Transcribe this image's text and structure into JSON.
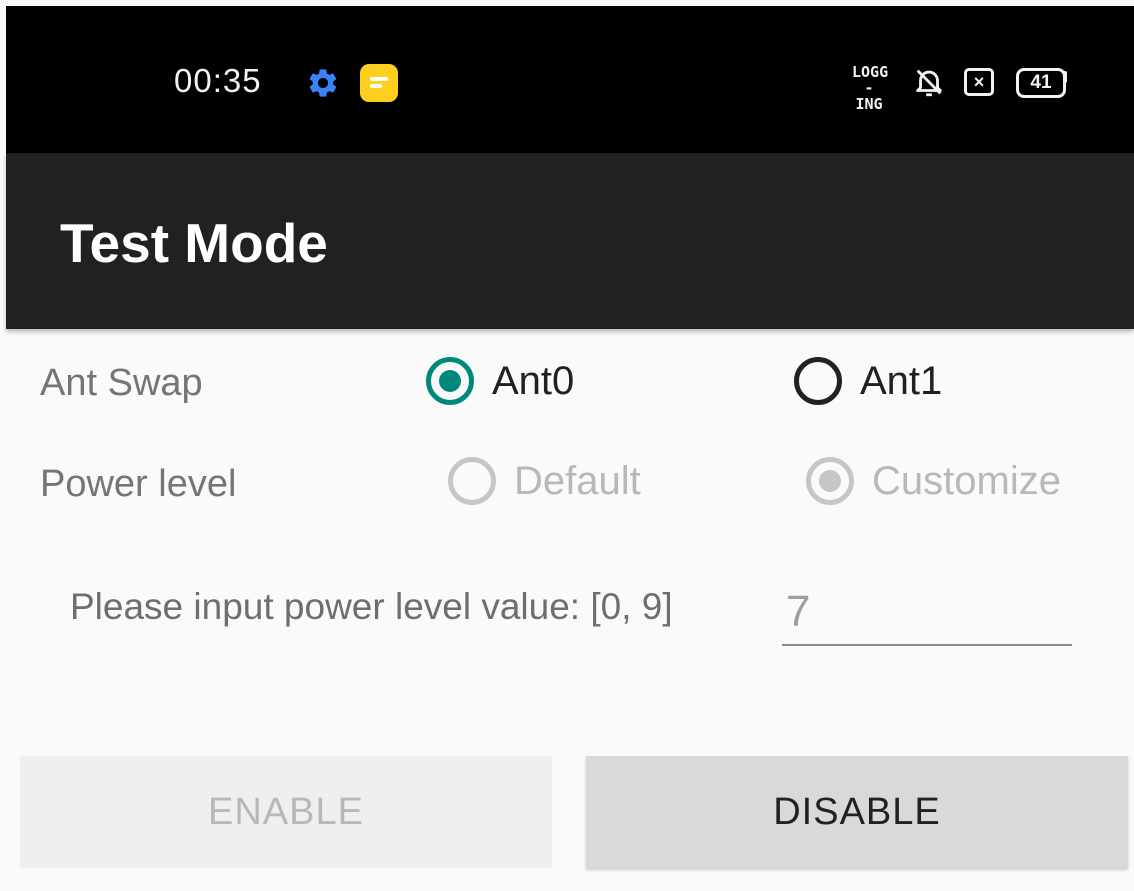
{
  "status_bar": {
    "time": "00:35",
    "logging_line1": "LOGG",
    "logging_line2": "-ING",
    "battery_level": "41",
    "icons": [
      "settings-gear-icon",
      "messages-app-icon",
      "logging-icon",
      "bell-off-icon",
      "close-box-icon",
      "battery-icon"
    ],
    "colors": {
      "gear": "#3b82f6",
      "messages": "#ffcf1f"
    }
  },
  "action_bar": {
    "title": "Test Mode"
  },
  "ant_swap": {
    "label": "Ant Swap",
    "options": [
      {
        "label": "Ant0",
        "checked": true
      },
      {
        "label": "Ant1",
        "checked": false
      }
    ]
  },
  "power_level": {
    "label": "Power level",
    "options": [
      {
        "label": "Default",
        "checked": false
      },
      {
        "label": "Customize",
        "checked": true
      }
    ]
  },
  "power_input": {
    "prompt": "Please input power level value: [0, 9]",
    "value": "7"
  },
  "buttons": {
    "enable": "ENABLE",
    "disable": "DISABLE"
  },
  "colors": {
    "accent": "#00897b",
    "action_bar": "#212121",
    "status_bar": "#000000"
  }
}
